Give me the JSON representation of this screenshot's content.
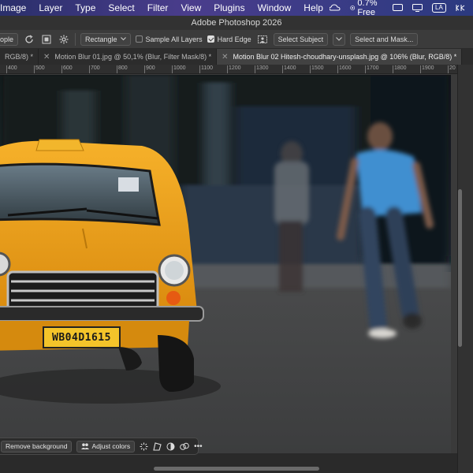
{
  "menubar": {
    "items": [
      "Image",
      "Layer",
      "Type",
      "Select",
      "Filter",
      "View",
      "Plugins",
      "Window",
      "Help"
    ],
    "status": {
      "memory": "0.7% Free",
      "user_badge": "LA"
    }
  },
  "window": {
    "title": "Adobe Photoshop 2026"
  },
  "options": {
    "people_label": "ople",
    "shape_select": "Rectangle",
    "sample_all_layers": "Sample All Layers",
    "hard_edge": "Hard Edge",
    "select_subject": "Select Subject",
    "select_and_mask": "Select and Mask..."
  },
  "tabs": [
    {
      "label": "RGB/8) *",
      "active": false
    },
    {
      "label": "Motion Blur 01.jpg @ 50,1% (Blur, Filter Mask/8) *",
      "active": false
    },
    {
      "label": "Motion Blur 02 Hitesh-choudhary-unsplash.jpg @ 106% (Blur, RGB/8) *",
      "active": true
    }
  ],
  "ruler": {
    "ticks": [
      "400",
      "500",
      "600",
      "700",
      "800",
      "900",
      "1000",
      "1100",
      "1200",
      "1300",
      "1400",
      "1500",
      "1600",
      "1700",
      "1800",
      "1900",
      "20"
    ]
  },
  "canvas": {
    "plate_text": "WB04D1615"
  },
  "taskbar": {
    "remove_background": "Remove background",
    "adjust_colors": "Adjust colors",
    "more": "•••"
  },
  "colors": {
    "menubar_gradient_start": "#2a2f6b",
    "taxi_yellow": "#f2a516",
    "shirt_blue": "#3f8fd0",
    "panel_bg": "#3b3b3b"
  },
  "icons": {
    "rotate": "rotate-icon",
    "gear": "gear-icon",
    "chevron": "chevron-down-icon"
  }
}
